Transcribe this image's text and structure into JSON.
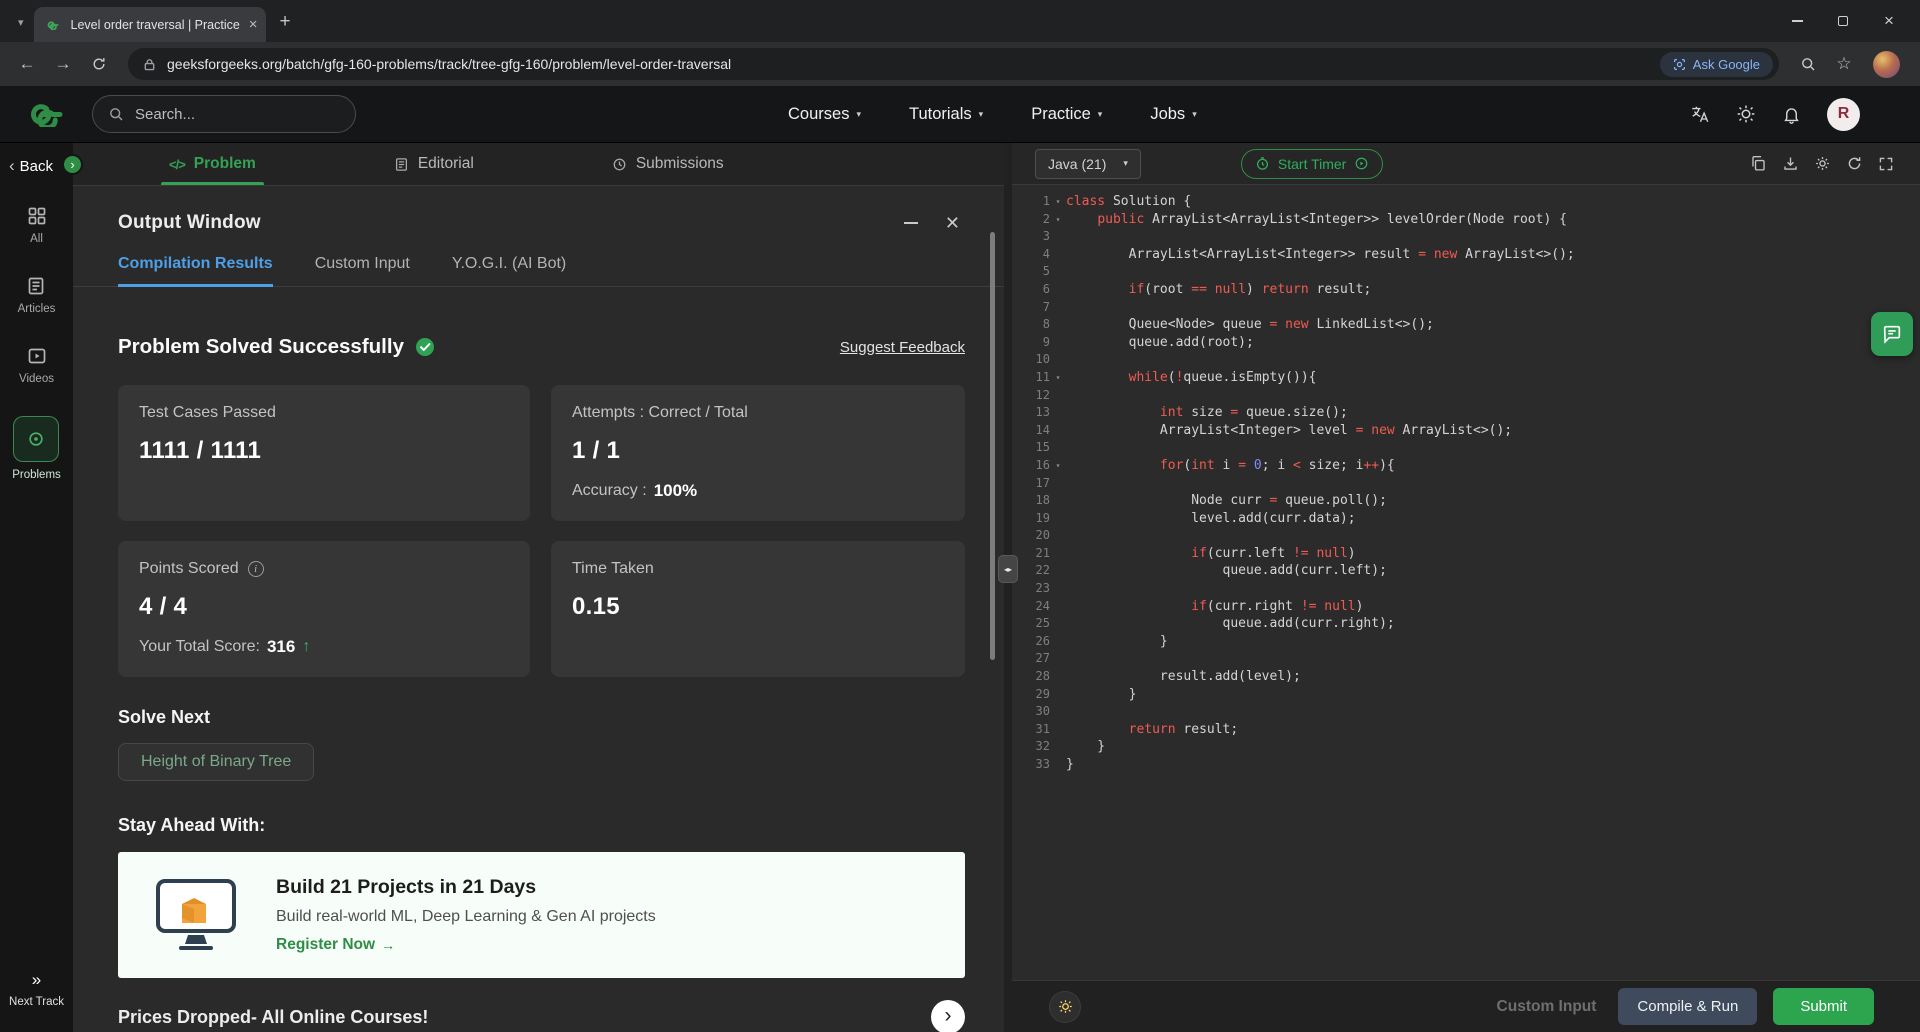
{
  "colors": {
    "brand_green": "#2f8d46",
    "tab_blue": "#4f9fe6",
    "keyword_red": "#ef5b52",
    "number_blue": "#7e8ef7",
    "submit_green": "#2da44e"
  },
  "browser": {
    "tab_title": "Level order traversal | Practice |",
    "url": "geeksforgeeks.org/batch/gfg-160-problems/track/tree-gfg-160/problem/level-order-traversal",
    "ask_google": "Ask Google"
  },
  "header": {
    "search_placeholder": "Search...",
    "nav": {
      "courses": "Courses",
      "tutorials": "Tutorials",
      "practice": "Practice",
      "jobs": "Jobs"
    },
    "avatar_initial": "R"
  },
  "sidebar": {
    "back_label": "Back",
    "all": "All",
    "articles": "Articles",
    "videos": "Videos",
    "problems": "Problems",
    "next_track": "Next Track"
  },
  "tabs": {
    "problem": "Problem",
    "editorial": "Editorial",
    "submissions": "Submissions"
  },
  "output": {
    "title": "Output Window",
    "tab_compilation": "Compilation Results",
    "tab_custom_input": "Custom Input",
    "tab_yogi": "Y.O.G.I. (AI Bot)",
    "status": "Problem Solved Successfully",
    "suggest_feedback": "Suggest Feedback",
    "test_cases_label": "Test Cases Passed",
    "test_cases_value": "1111 / 1111",
    "attempts_label": "Attempts : Correct / Total",
    "attempts_value": "1 / 1",
    "accuracy_label": "Accuracy :",
    "accuracy_value": "100%",
    "points_label": "Points Scored",
    "points_value": "4 / 4",
    "total_score_label": "Your Total Score:",
    "total_score_value": "316",
    "time_label": "Time Taken",
    "time_value": "0.15",
    "solve_next": "Solve Next",
    "next_problem": "Height of Binary Tree",
    "stay_ahead": "Stay Ahead With:",
    "banner_title": "Build 21 Projects in 21 Days",
    "banner_subtitle": "Build real-world ML, Deep Learning & Gen AI projects",
    "banner_cta": "Register Now",
    "promo": "Prices Dropped- All Online Courses!"
  },
  "editor": {
    "language": "Java (21)",
    "start_timer": "Start Timer",
    "custom_input": "Custom Input",
    "compile_run": "Compile & Run",
    "submit": "Submit",
    "code": [
      {
        "n": 1,
        "fold": true,
        "t": [
          [
            "k",
            "class"
          ],
          [
            "d",
            " Solution {"
          ]
        ]
      },
      {
        "n": 2,
        "fold": true,
        "t": [
          [
            "d",
            "    "
          ],
          [
            "k",
            "public"
          ],
          [
            "d",
            " ArrayList<ArrayList<Integer>> levelOrder(Node root) {"
          ]
        ]
      },
      {
        "n": 3,
        "t": []
      },
      {
        "n": 4,
        "t": [
          [
            "d",
            "        ArrayList<ArrayList<Integer>> result "
          ],
          [
            "k",
            "="
          ],
          [
            "d",
            " "
          ],
          [
            "k",
            "new"
          ],
          [
            "d",
            " ArrayList<>();"
          ]
        ]
      },
      {
        "n": 5,
        "t": []
      },
      {
        "n": 6,
        "t": [
          [
            "d",
            "        "
          ],
          [
            "k",
            "if"
          ],
          [
            "d",
            "(root "
          ],
          [
            "k",
            "=="
          ],
          [
            "d",
            " "
          ],
          [
            "k",
            "null"
          ],
          [
            "d",
            ") "
          ],
          [
            "k",
            "return"
          ],
          [
            "d",
            " result;"
          ]
        ]
      },
      {
        "n": 7,
        "t": []
      },
      {
        "n": 8,
        "t": [
          [
            "d",
            "        Queue<Node> queue "
          ],
          [
            "k",
            "="
          ],
          [
            "d",
            " "
          ],
          [
            "k",
            "new"
          ],
          [
            "d",
            " LinkedList<>();"
          ]
        ]
      },
      {
        "n": 9,
        "t": [
          [
            "d",
            "        queue.add(root);"
          ]
        ]
      },
      {
        "n": 10,
        "t": []
      },
      {
        "n": 11,
        "fold": true,
        "t": [
          [
            "d",
            "        "
          ],
          [
            "k",
            "while"
          ],
          [
            "d",
            "("
          ],
          [
            "k",
            "!"
          ],
          [
            "d",
            "queue.isEmpty()){"
          ]
        ]
      },
      {
        "n": 12,
        "t": []
      },
      {
        "n": 13,
        "t": [
          [
            "d",
            "            "
          ],
          [
            "k",
            "int"
          ],
          [
            "d",
            " size "
          ],
          [
            "k",
            "="
          ],
          [
            "d",
            " queue.size();"
          ]
        ]
      },
      {
        "n": 14,
        "t": [
          [
            "d",
            "            ArrayList<Integer> level "
          ],
          [
            "k",
            "="
          ],
          [
            "d",
            " "
          ],
          [
            "k",
            "new"
          ],
          [
            "d",
            " ArrayList<>();"
          ]
        ]
      },
      {
        "n": 15,
        "t": []
      },
      {
        "n": 16,
        "fold": true,
        "t": [
          [
            "d",
            "            "
          ],
          [
            "k",
            "for"
          ],
          [
            "d",
            "("
          ],
          [
            "k",
            "int"
          ],
          [
            "d",
            " i "
          ],
          [
            "k",
            "="
          ],
          [
            "d",
            " "
          ],
          [
            "n",
            "0"
          ],
          [
            "d",
            "; i "
          ],
          [
            "k",
            "<"
          ],
          [
            "d",
            " size; i"
          ],
          [
            "k",
            "++"
          ],
          [
            "d",
            "){"
          ]
        ]
      },
      {
        "n": 17,
        "t": []
      },
      {
        "n": 18,
        "t": [
          [
            "d",
            "                Node curr "
          ],
          [
            "k",
            "="
          ],
          [
            "d",
            " queue.poll();"
          ]
        ]
      },
      {
        "n": 19,
        "t": [
          [
            "d",
            "                level.add(curr.data);"
          ]
        ]
      },
      {
        "n": 20,
        "t": []
      },
      {
        "n": 21,
        "t": [
          [
            "d",
            "                "
          ],
          [
            "k",
            "if"
          ],
          [
            "d",
            "(curr.left "
          ],
          [
            "k",
            "!="
          ],
          [
            "d",
            " "
          ],
          [
            "k",
            "null"
          ],
          [
            "d",
            ")"
          ]
        ]
      },
      {
        "n": 22,
        "t": [
          [
            "d",
            "                    queue.add(curr.left);"
          ]
        ]
      },
      {
        "n": 23,
        "t": []
      },
      {
        "n": 24,
        "t": [
          [
            "d",
            "                "
          ],
          [
            "k",
            "if"
          ],
          [
            "d",
            "(curr.right "
          ],
          [
            "k",
            "!="
          ],
          [
            "d",
            " "
          ],
          [
            "k",
            "null"
          ],
          [
            "d",
            ")"
          ]
        ]
      },
      {
        "n": 25,
        "t": [
          [
            "d",
            "                    queue.add(curr.right);"
          ]
        ]
      },
      {
        "n": 26,
        "t": [
          [
            "d",
            "            }"
          ]
        ]
      },
      {
        "n": 27,
        "t": []
      },
      {
        "n": 28,
        "t": [
          [
            "d",
            "            result.add(level);"
          ]
        ]
      },
      {
        "n": 29,
        "t": [
          [
            "d",
            "        }"
          ]
        ]
      },
      {
        "n": 30,
        "t": []
      },
      {
        "n": 31,
        "t": [
          [
            "d",
            "        "
          ],
          [
            "k",
            "return"
          ],
          [
            "d",
            " result;"
          ]
        ]
      },
      {
        "n": 32,
        "t": [
          [
            "d",
            "    }"
          ]
        ]
      },
      {
        "n": 33,
        "t": [
          [
            "d",
            "}"
          ]
        ]
      }
    ]
  }
}
